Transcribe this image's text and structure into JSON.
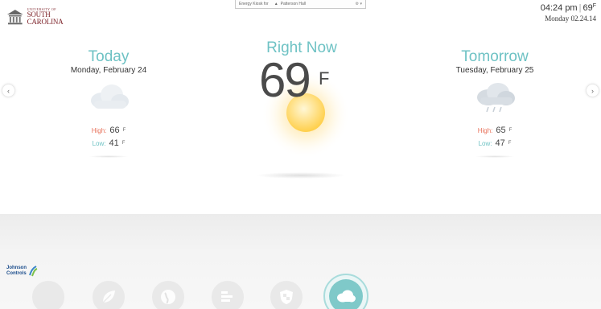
{
  "header": {
    "logo_small": "UNIVERSITY OF",
    "logo_big": "SOUTH CAROLINA",
    "kiosk_label": "Energy Kiosk for",
    "kiosk_building": "Patterson Hall",
    "clock_time": "04:24 pm",
    "clock_temp": "69",
    "clock_unit": "F",
    "clock_date": "Monday 02.24.14"
  },
  "today": {
    "title": "Today",
    "date": "Monday, February 24",
    "high_label": "High:",
    "high": "66",
    "low_label": "Low:",
    "low": "41",
    "unit": "F",
    "icon": "cloudy-icon"
  },
  "now": {
    "title": "Right Now",
    "temp": "69",
    "unit": "F",
    "icon": "sun-icon"
  },
  "tomorrow": {
    "title": "Tomorrow",
    "date": "Tuesday, February 25",
    "high_label": "High:",
    "high": "65",
    "low_label": "Low:",
    "low": "47",
    "unit": "F",
    "icon": "rain-cloud-icon"
  },
  "nav": {
    "prev": "‹",
    "next": "›"
  },
  "dock": {
    "brand_line1": "Johnson",
    "brand_line2": "Controls",
    "items": [
      "leaf-icon",
      "globe-icon",
      "bar-chart-icon",
      "shield-icon",
      "weather-cloud-icon"
    ],
    "active": "weather-cloud-icon"
  },
  "colors": {
    "accent": "#6ec2c4",
    "high": "#e8735c",
    "brand": "#7a1d24"
  }
}
